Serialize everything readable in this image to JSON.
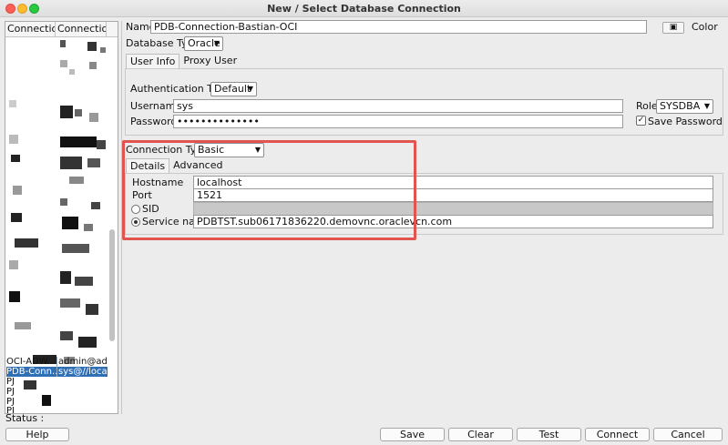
{
  "window": {
    "title": "New / Select Database Connection"
  },
  "connection_list": {
    "headers": [
      "Connectio...",
      "Connectio..."
    ],
    "rows": [
      {
        "name": "OCI-ADW...",
        "details": "admin@ad..."
      },
      {
        "name": "PDB-Conn...",
        "details": "sys@//loca..."
      },
      {
        "name": "PJ",
        "details": ""
      },
      {
        "name": "PJ",
        "details": ""
      },
      {
        "name": "PJ",
        "details": ""
      },
      {
        "name": "PJ",
        "details": ""
      }
    ]
  },
  "form": {
    "name_label": "Name",
    "name_value": "PDB-Connection-Bastian-OCI",
    "color_label": "Color",
    "db_type_label": "Database Type",
    "db_type_value": "Oracle",
    "tabs": [
      "User Info",
      "Proxy User"
    ],
    "auth_type_label": "Authentication Type",
    "auth_type_value": "Default",
    "username_label": "Username",
    "username_value": "sys",
    "role_label": "Role",
    "role_value": "SYSDBA",
    "password_label": "Password",
    "password_value": "••••••••••••••",
    "save_password_label": "Save Password",
    "connection_type_label": "Connection Type",
    "connection_type_value": "Basic",
    "conn_tabs": [
      "Details",
      "Advanced"
    ],
    "hostname_label": "Hostname",
    "hostname_value": "localhost",
    "port_label": "Port",
    "port_value": "1521",
    "sid_label": "SID",
    "service_name_label": "Service name",
    "service_name_value": "PDBTST.sub06171836220.demovnc.oraclevcn.com"
  },
  "status": {
    "label": "Status :"
  },
  "buttons": {
    "help": "Help",
    "save": "Save",
    "clear": "Clear",
    "test": "Test",
    "connect": "Connect",
    "cancel": "Cancel"
  },
  "colors": {
    "highlight": "#e1544f",
    "selected_row": "#2f6fb5"
  }
}
